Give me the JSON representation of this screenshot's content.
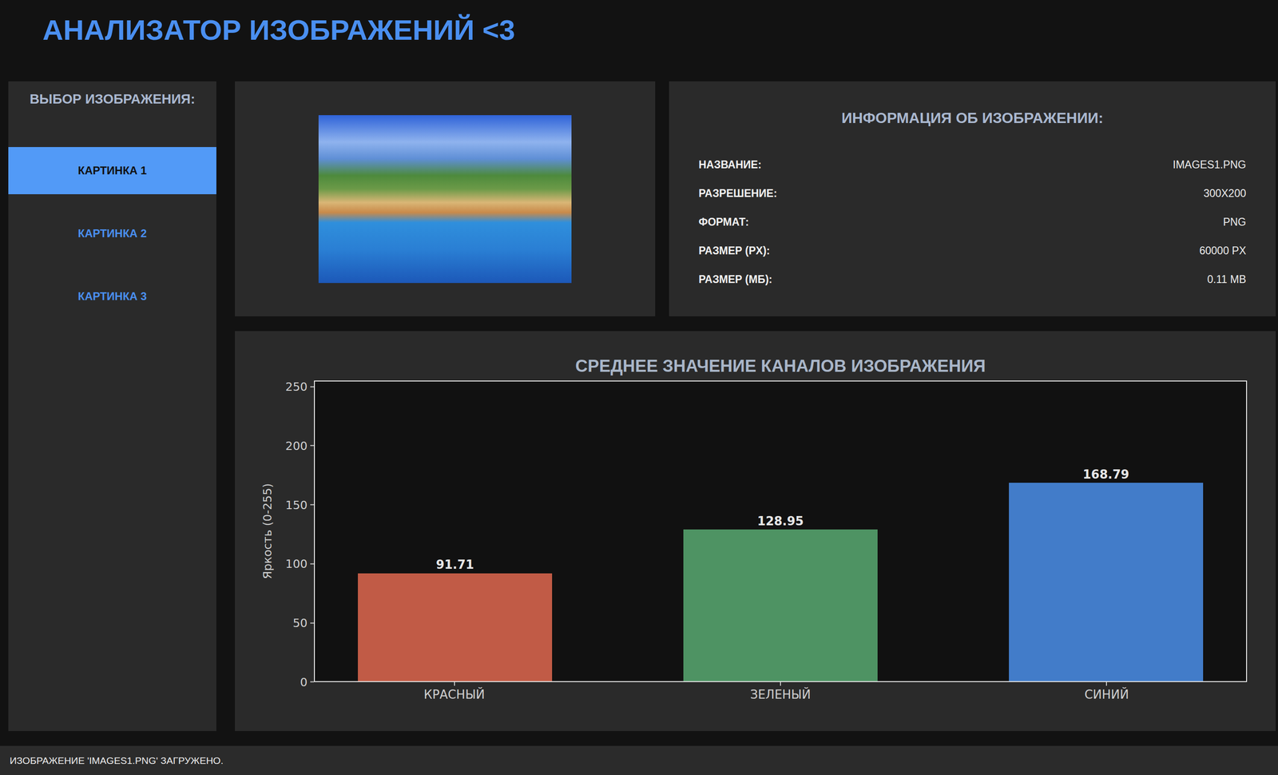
{
  "header": {
    "title": "АНАЛИЗАТОР ИЗОБРАЖЕНИЙ <3"
  },
  "sidebar": {
    "title": "ВЫБОР ИЗОБРАЖЕНИЯ:",
    "items": [
      {
        "label": "КАРТИНКА 1",
        "selected": true
      },
      {
        "label": "КАРТИНКА 2",
        "selected": false
      },
      {
        "label": "КАРТИНКА 3",
        "selected": false
      }
    ]
  },
  "info": {
    "title": "ИНФОРМАЦИЯ ОБ ИЗОБРАЖЕНИИ:",
    "rows": [
      {
        "label": "НАЗВАНИЕ:",
        "value": "IMAGES1.PNG"
      },
      {
        "label": "РАЗРЕШЕНИЕ:",
        "value": "300X200"
      },
      {
        "label": "ФОРМАТ:",
        "value": "PNG"
      },
      {
        "label": "РАЗМЕР (PX):",
        "value": "60000 PX"
      },
      {
        "label": "РАЗМЕР (МБ):",
        "value": "0.11 MB"
      }
    ]
  },
  "chart": {
    "title": "СРЕДНЕЕ ЗНАЧЕНИЕ КАНАЛОВ ИЗОБРАЖЕНИЯ",
    "y_axis": {
      "label": "Яркость (0-255)",
      "ticks": [
        "0",
        "50",
        "100",
        "150",
        "200",
        "250"
      ]
    },
    "categories": [
      "КРАСНЫЙ",
      "ЗЕЛЕНЫЙ",
      "СИНИЙ"
    ],
    "series": [
      {
        "values": [
          91.71,
          128.95,
          168.79
        ],
        "value_labels": [
          "91.71",
          "128.95",
          "168.79"
        ],
        "colors": [
          "#c15b46",
          "#4e9363",
          "#427cc9"
        ]
      }
    ]
  },
  "status_bar": "ИЗОБРАЖЕНИЕ 'IMAGES1.PNG' ЗАГРУЖЕНО."
}
